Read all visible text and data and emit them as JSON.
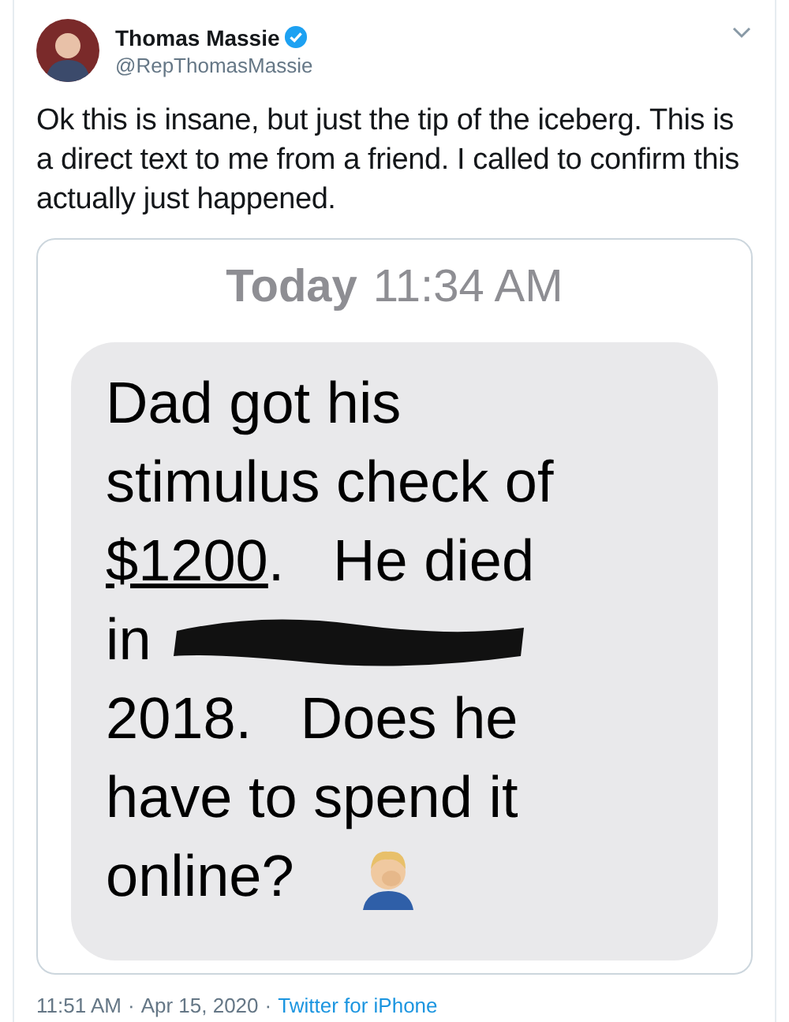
{
  "tweet": {
    "author": "Thomas Massie",
    "verified": true,
    "handle": "@RepThomasMassie",
    "text": "Ok this is insane, but just the tip of the iceberg. This is a direct text to me from a friend. I called to confirm this actually just happened.",
    "attachment": {
      "timestamp_day": "Today",
      "timestamp_time": "11:34 AM",
      "lines": [
        {
          "parts": [
            {
              "kind": "text",
              "text": "Dad got his",
              "underlined": false
            }
          ]
        },
        {
          "parts": [
            {
              "kind": "text",
              "text": "stimulus check of",
              "underlined": false
            }
          ]
        },
        {
          "parts": [
            {
              "kind": "text",
              "text": "$1200",
              "underlined": true
            },
            {
              "kind": "text",
              "text": ".   He died",
              "underlined": false
            }
          ]
        },
        {
          "parts": [
            {
              "kind": "text",
              "text": "in",
              "underlined": false
            },
            {
              "kind": "redacted"
            }
          ]
        },
        {
          "parts": [
            {
              "kind": "text",
              "text": "2018.   Does he",
              "underlined": false
            }
          ]
        },
        {
          "parts": [
            {
              "kind": "text",
              "text": "have to spend it",
              "underlined": false
            }
          ]
        },
        {
          "parts": [
            {
              "kind": "text",
              "text": "online?",
              "underlined": false
            },
            {
              "kind": "emoji"
            }
          ]
        }
      ]
    },
    "time": "11:51 AM",
    "separators": [
      "·",
      "·"
    ],
    "date": "Apr 15, 2020",
    "source": "Twitter for iPhone"
  }
}
